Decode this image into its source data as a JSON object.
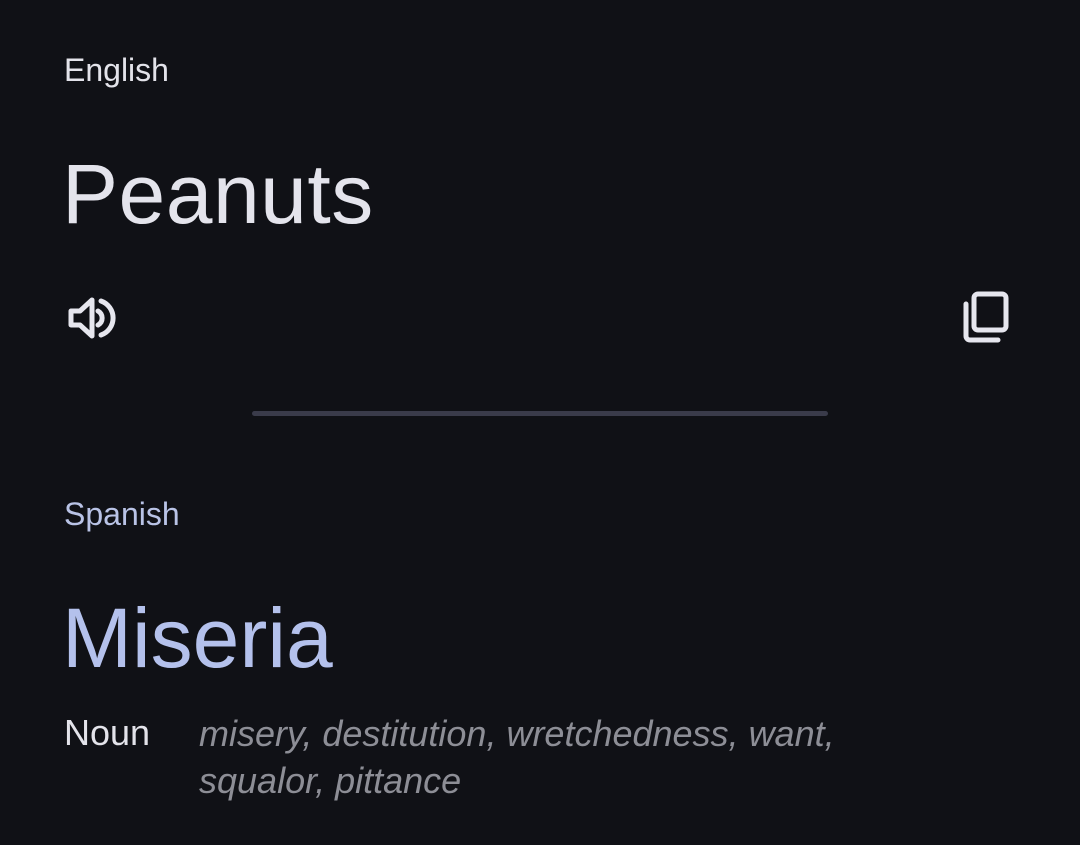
{
  "source": {
    "language": "English",
    "text": "Peanuts",
    "listen_icon": "speaker-icon"
  },
  "actions": {
    "copy_icon": "copy-icon"
  },
  "translation": {
    "language": "Spanish",
    "text": "Miseria",
    "part_of_speech": "Noun",
    "synonyms": "misery, destitution, wretchedness, want, squalor, pittance"
  },
  "colors": {
    "background": "#101116",
    "primary_text": "#e4e4ec",
    "accent_text": "#b4c1ec",
    "muted_text": "#8d8e96",
    "divider": "#3a3b4a"
  }
}
